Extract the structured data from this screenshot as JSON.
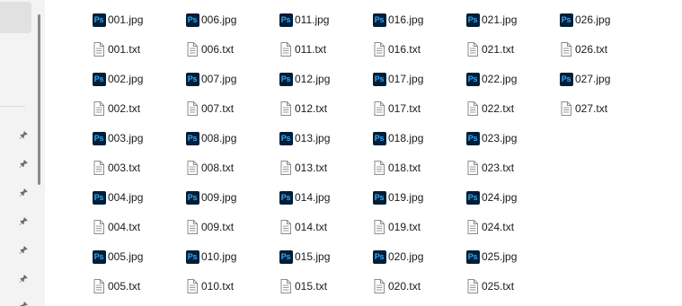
{
  "icons": {
    "jpg": "photoshop-file-icon",
    "txt": "text-document-icon",
    "pin": "pin-icon"
  },
  "ps_icon_label": "Ps",
  "colors": {
    "ps_background": "#001e36",
    "ps_text": "#31a8ff",
    "content_background": "#ffffff",
    "nav_background": "#f3f3f3"
  },
  "files": {
    "columns": [
      [
        "001.jpg",
        "001.txt",
        "002.jpg",
        "002.txt",
        "003.jpg",
        "003.txt",
        "004.jpg",
        "004.txt",
        "005.jpg",
        "005.txt"
      ],
      [
        "006.jpg",
        "006.txt",
        "007.jpg",
        "007.txt",
        "008.jpg",
        "008.txt",
        "009.jpg",
        "009.txt",
        "010.jpg",
        "010.txt"
      ],
      [
        "011.jpg",
        "011.txt",
        "012.jpg",
        "012.txt",
        "013.jpg",
        "013.txt",
        "014.jpg",
        "014.txt",
        "015.jpg",
        "015.txt"
      ],
      [
        "016.jpg",
        "016.txt",
        "017.jpg",
        "017.txt",
        "018.jpg",
        "018.txt",
        "019.jpg",
        "019.txt",
        "020.jpg",
        "020.txt"
      ],
      [
        "021.jpg",
        "021.txt",
        "022.jpg",
        "022.txt",
        "023.jpg",
        "023.txt",
        "024.jpg",
        "024.txt",
        "025.jpg",
        "025.txt"
      ],
      [
        "026.jpg",
        "026.txt",
        "027.jpg",
        "027.txt"
      ]
    ]
  }
}
